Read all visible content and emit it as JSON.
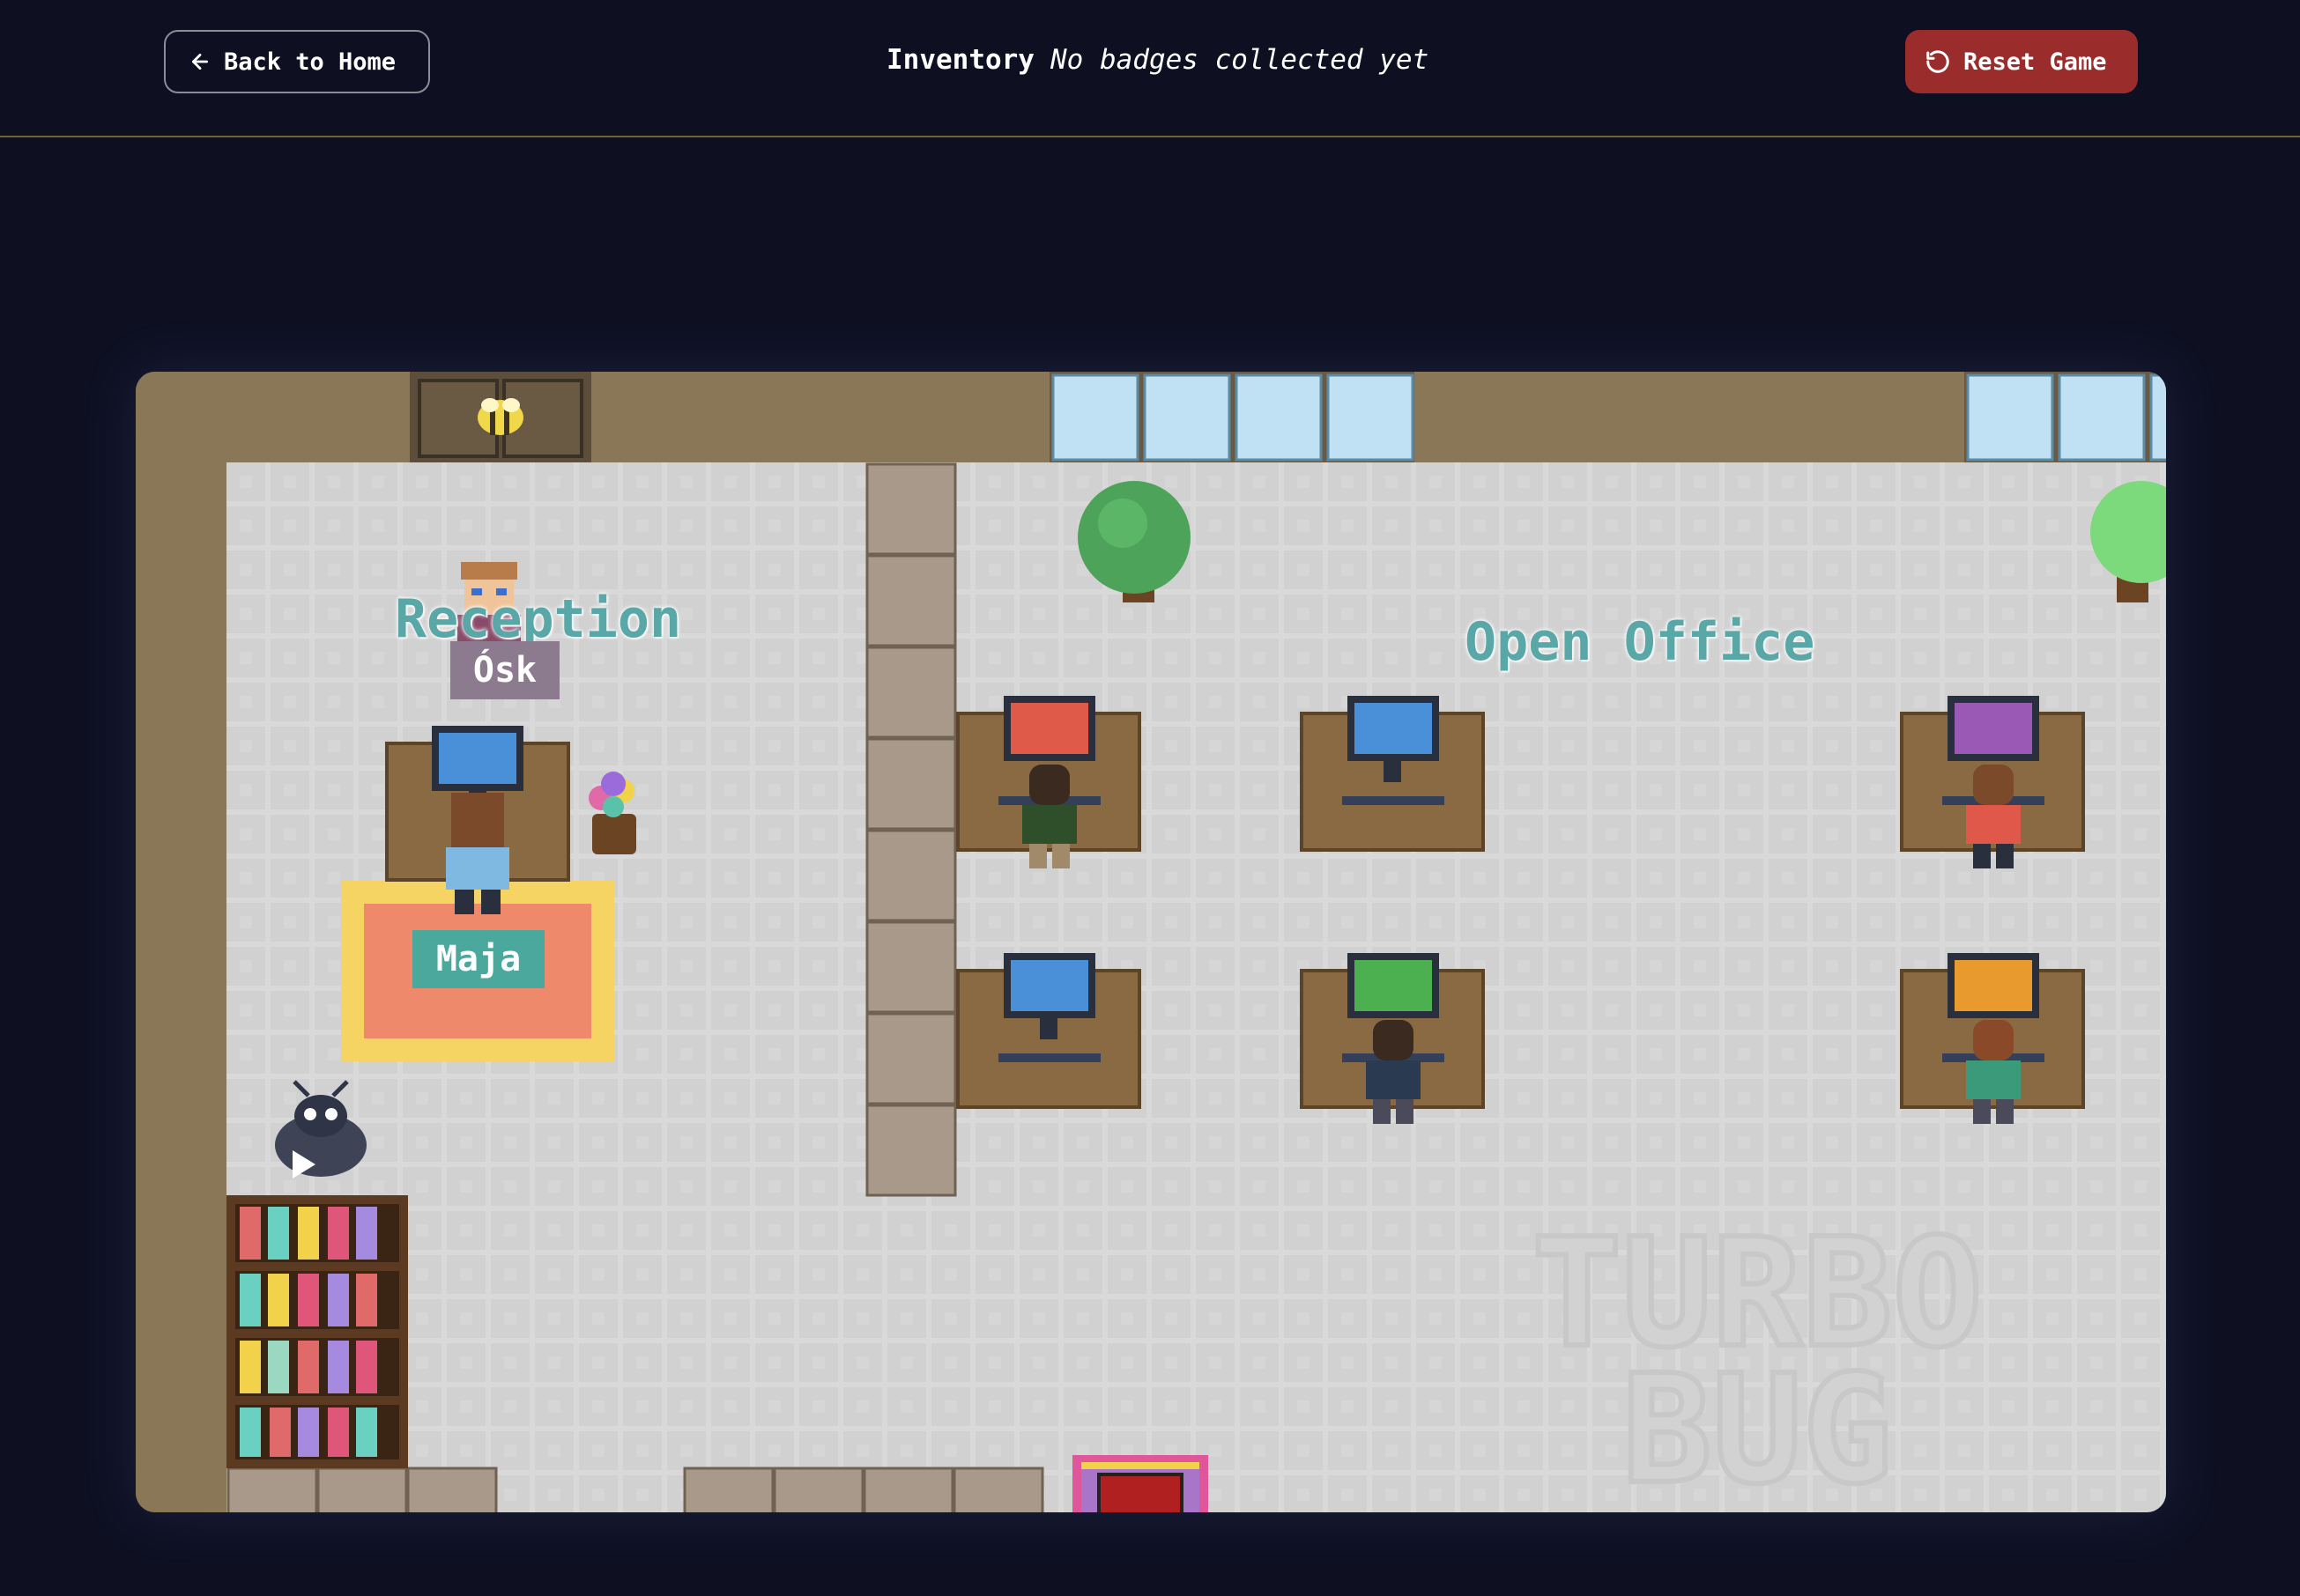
{
  "header": {
    "back_label": "Back to Home",
    "back_icon": "arrow-left-icon",
    "inventory_title": "Inventory",
    "inventory_status": "No badges collected yet",
    "reset_label": "Reset Game",
    "reset_icon": "rotate-ccw-icon",
    "reset_color": "#9b2c2c",
    "divider_color": "#6e6630",
    "background": "#0e1022"
  },
  "game": {
    "zones": {
      "reception": "Reception",
      "open_office": "Open Office"
    },
    "npcs": {
      "receptionist": "Ósk",
      "desk_worker": "Maja"
    },
    "watermark": [
      "TURBO",
      "BUG"
    ],
    "monitor_colors": [
      "#4a90d9",
      "#e05a4a",
      "#4a90d9",
      "#9b59b6",
      "#4a90d9",
      "#4caf50",
      "#e89a2e"
    ],
    "wall_color": "#8a7758",
    "floor_color": "#d9d9d9"
  }
}
